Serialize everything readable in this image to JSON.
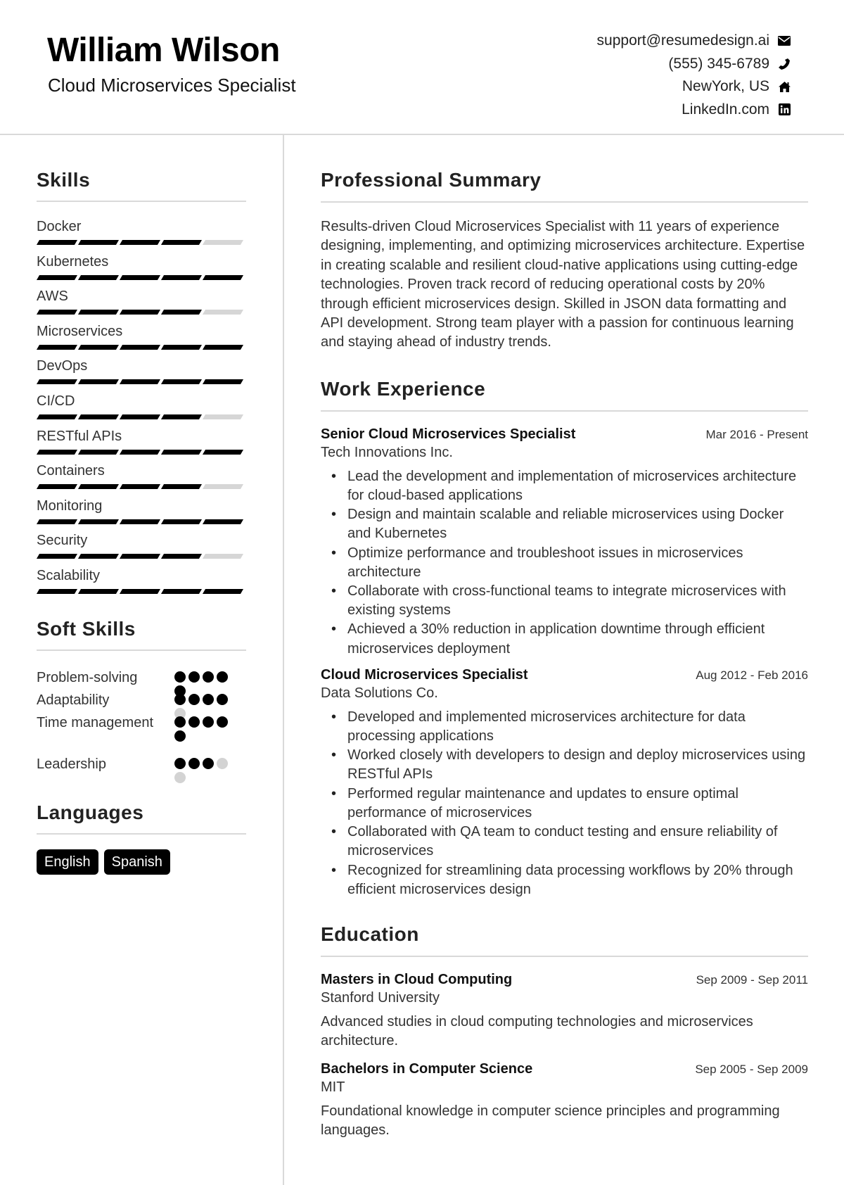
{
  "header": {
    "name": "William Wilson",
    "title": "Cloud Microservices Specialist",
    "contacts": [
      {
        "text": "support@resumedesign.ai",
        "icon": "envelope-icon"
      },
      {
        "text": "(555) 345-6789",
        "icon": "phone-icon"
      },
      {
        "text": "NewYork, US",
        "icon": "home-icon"
      },
      {
        "text": "LinkedIn.com",
        "icon": "linkedin-icon"
      }
    ]
  },
  "skills": {
    "heading": "Skills",
    "max": 5,
    "items": [
      {
        "name": "Docker",
        "level": 4
      },
      {
        "name": "Kubernetes",
        "level": 5
      },
      {
        "name": "AWS",
        "level": 4
      },
      {
        "name": "Microservices",
        "level": 5
      },
      {
        "name": "DevOps",
        "level": 5
      },
      {
        "name": "CI/CD",
        "level": 4
      },
      {
        "name": "RESTful APIs",
        "level": 5
      },
      {
        "name": "Containers",
        "level": 4
      },
      {
        "name": "Monitoring",
        "level": 5
      },
      {
        "name": "Security",
        "level": 4
      },
      {
        "name": "Scalability",
        "level": 5
      }
    ]
  },
  "soft_skills": {
    "heading": "Soft Skills",
    "max": 5,
    "items": [
      {
        "name": "Problem-solving",
        "level": 5
      },
      {
        "name": "Adaptability",
        "level": 4
      },
      {
        "name": "Time management",
        "level": 5
      },
      {
        "name": "Leadership",
        "level": 3
      }
    ]
  },
  "languages": {
    "heading": "Languages",
    "items": [
      "English",
      "Spanish"
    ]
  },
  "summary": {
    "heading": "Professional Summary",
    "text": "Results-driven Cloud Microservices Specialist with 11 years of experience designing, implementing, and optimizing microservices architecture. Expertise in creating scalable and resilient cloud-native applications using cutting-edge technologies. Proven track record of reducing operational costs by 20% through efficient microservices design. Skilled in JSON data formatting and API development. Strong team player with a passion for continuous learning and staying ahead of industry trends."
  },
  "work": {
    "heading": "Work Experience",
    "jobs": [
      {
        "title": "Senior Cloud Microservices Specialist",
        "dates": "Mar 2016 - Present",
        "company": "Tech Innovations Inc.",
        "bullets": [
          "Lead the development and implementation of microservices architecture for cloud-based applications",
          "Design and maintain scalable and reliable microservices using Docker and Kubernetes",
          "Optimize performance and troubleshoot issues in microservices architecture",
          "Collaborate with cross-functional teams to integrate microservices with existing systems",
          "Achieved a 30% reduction in application downtime through efficient microservices deployment"
        ]
      },
      {
        "title": "Cloud Microservices Specialist",
        "dates": "Aug 2012 - Feb 2016",
        "company": "Data Solutions Co.",
        "bullets": [
          "Developed and implemented microservices architecture for data processing applications",
          "Worked closely with developers to design and deploy microservices using RESTful APIs",
          "Performed regular maintenance and updates to ensure optimal performance of microservices",
          "Collaborated with QA team to conduct testing and ensure reliability of microservices",
          "Recognized for streamlining data processing workflows by 20% through efficient microservices design"
        ]
      }
    ]
  },
  "education": {
    "heading": "Education",
    "degrees": [
      {
        "degree": "Masters in Cloud Computing",
        "dates": "Sep 2009 - Sep 2011",
        "school": "Stanford University",
        "description": "Advanced studies in cloud computing technologies and microservices architecture."
      },
      {
        "degree": "Bachelors in Computer Science",
        "dates": "Sep 2005 - Sep 2009",
        "school": "MIT",
        "description": "Foundational knowledge in computer science principles and programming languages."
      }
    ]
  }
}
